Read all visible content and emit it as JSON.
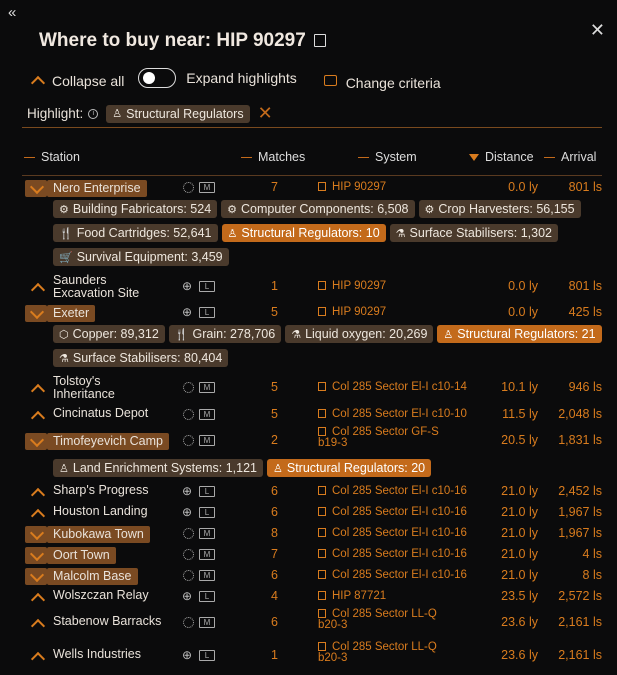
{
  "title": "Where to buy near: HIP 90297",
  "toolbar": {
    "collapse_all": "Collapse all",
    "expand_highlights": "Expand highlights",
    "change_criteria": "Change criteria"
  },
  "highlight": {
    "label": "Highlight:",
    "info_glyph": "i",
    "chip": "Structural Regulators"
  },
  "columns": {
    "station": "Station",
    "matches": "Matches",
    "system": "System",
    "distance": "Distance",
    "arrival": "Arrival"
  },
  "rows": [
    {
      "name": "Nero Enterprise",
      "pad": "M",
      "matches": "7",
      "system": "HIP 90297",
      "distance": "0.0 ly",
      "arrival": "801 ls",
      "chips": [
        [
          "Building Fabricators: 524",
          "Computer Components: 6,508",
          "Crop Harvesters: 56,155"
        ],
        [
          "Food Cartridges: 52,641",
          "Structural Regulators: 10",
          "Surface Stabilisers: 1,302"
        ],
        [
          "Survival Equipment: 3,459"
        ]
      ]
    },
    {
      "name1": "Saunders",
      "name2": "Excavation Site",
      "pad": "L",
      "matches": "1",
      "system": "HIP 90297",
      "distance": "0.0 ly",
      "arrival": "801 ls"
    },
    {
      "name": "Exeter",
      "pad": "L",
      "matches": "5",
      "system": "HIP 90297",
      "distance": "0.0 ly",
      "arrival": "425 ls",
      "chips": [
        [
          "Copper: 89,312",
          "Grain: 278,706",
          "Liquid oxygen: 20,269",
          "Structural Regulators: 21"
        ],
        [
          "Surface Stabilisers: 80,404"
        ]
      ]
    },
    {
      "name1": "Tolstoy's",
      "name2": "Inheritance",
      "pad": "M",
      "matches": "5",
      "system": "Col 285 Sector El-I c10-14",
      "distance": "10.1 ly",
      "arrival": "946 ls"
    },
    {
      "name": "Cincinatus Depot",
      "pad": "M",
      "matches": "5",
      "system": "Col 285 Sector El-I c10-10",
      "distance": "11.5 ly",
      "arrival": "2,048 ls"
    },
    {
      "name": "Timofeyevich Camp",
      "pad": "M",
      "matches": "2",
      "system1": "Col 285 Sector GF-S",
      "system2": "b19-3",
      "distance": "20.5 ly",
      "arrival": "1,831 ls",
      "chips": [
        [
          "Land Enrichment Systems: 1,121",
          "Structural Regulators: 20"
        ]
      ]
    },
    {
      "name": "Sharp's Progress",
      "pad": "L",
      "matches": "6",
      "system": "Col 285 Sector El-I c10-16",
      "distance": "21.0 ly",
      "arrival": "2,452 ls"
    },
    {
      "name": "Houston Landing",
      "pad": "L",
      "matches": "6",
      "system": "Col 285 Sector El-I c10-16",
      "distance": "21.0 ly",
      "arrival": "1,967 ls"
    },
    {
      "name": "Kubokawa Town",
      "pad": "M",
      "matches": "8",
      "system": "Col 285 Sector El-I c10-16",
      "distance": "21.0 ly",
      "arrival": "1,967 ls"
    },
    {
      "name": "Oort Town",
      "pad": "M",
      "matches": "7",
      "system": "Col 285 Sector El-I c10-16",
      "distance": "21.0 ly",
      "arrival": "4 ls"
    },
    {
      "name": "Malcolm Base",
      "pad": "M",
      "matches": "6",
      "system": "Col 285 Sector El-I c10-16",
      "distance": "21.0 ly",
      "arrival": "8 ls"
    },
    {
      "name": "Wolszczan Relay",
      "pad": "L",
      "matches": "4",
      "system": "HIP 87721",
      "distance": "23.5 ly",
      "arrival": "2,572 ls"
    },
    {
      "name": "Stabenow Barracks",
      "pad": "M",
      "matches": "6",
      "system1": "Col 285 Sector LL-Q",
      "system2": "b20-3",
      "distance": "23.6 ly",
      "arrival": "2,161 ls"
    },
    {
      "name": "Wells Industries",
      "pad": "L",
      "matches": "1",
      "system1": "Col 285 Sector LL-Q",
      "system2": "b20-3",
      "distance": "23.6 ly",
      "arrival": "2,161 ls"
    }
  ]
}
